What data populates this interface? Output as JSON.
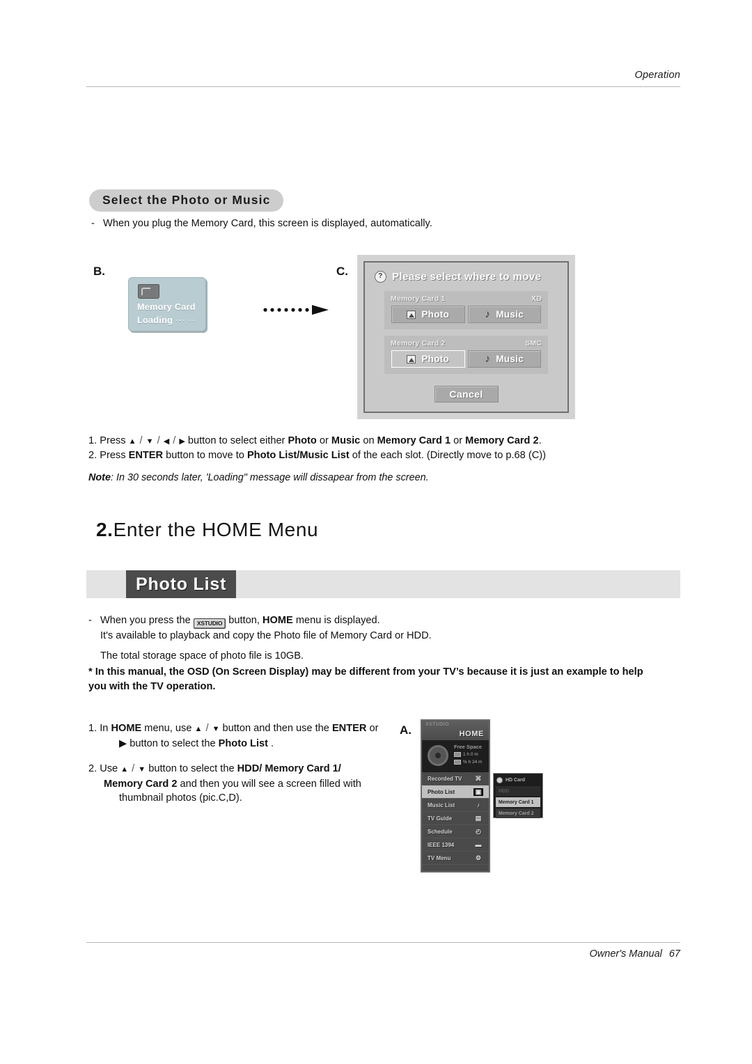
{
  "header": {
    "section_label": "Operation"
  },
  "footer": {
    "manual_label": "Owner's Manual",
    "page_number": "67"
  },
  "section": {
    "pill_title": "Select the Photo or Music",
    "lead_text": "When you plug the Memory Card, this screen is displayed, automatically."
  },
  "figure_b": {
    "label": "B.",
    "line1": "Memory Card",
    "line2": "Loading",
    "dots": "··· ··"
  },
  "figure_c": {
    "label": "C.",
    "title": "Please select where to move",
    "help_icon_glyph": "?",
    "slots": [
      {
        "name": "Memory Card 1",
        "type": "XD",
        "photo_label": "Photo",
        "music_label": "Music",
        "selected": "none"
      },
      {
        "name": "Memory Card 2",
        "type": "SMC",
        "photo_label": "Photo",
        "music_label": "Music",
        "selected": "photo"
      }
    ],
    "cancel_label": "Cancel"
  },
  "steps_top": {
    "s1_pre": "1. Press ",
    "s1_a": "▲",
    "s1_b": "▼",
    "s1_c": "◀",
    "s1_d": "▶",
    "s1_mid": " button to select either ",
    "s1_photo": "Photo",
    "s1_or": " or ",
    "s1_music": "Music",
    "s1_on": " on ",
    "s1_card1": "Memory Card 1",
    "s1_or2": " or ",
    "s1_card2": "Memory Card 2",
    "s1_end": ".",
    "s2_pre": "2. Press ",
    "s2_enter": "ENTER",
    "s2_mid": " button to move to ",
    "s2_lists": "Photo List/Music List",
    "s2_end": " of the each slot. (Directly move to p.68 (C))",
    "note_label": "Note",
    "note_text": ": In 30 seconds later, 'Loading\" message will dissapear from the screen."
  },
  "heading2": {
    "number": "2.",
    "text": "Enter the HOME Menu"
  },
  "banner": {
    "title": "Photo List"
  },
  "body": {
    "b1_dash": "-",
    "b1_pre": "When you press the ",
    "b1_btn": "XSTUDIO",
    "b1_mid": " button, ",
    "b1_home": "HOME",
    "b1_end": " menu is displayed.",
    "b2": "It's available to playback and copy the Photo file of Memory Card or HDD.",
    "b3": "The total storage space of photo file is 10GB.",
    "warn": "* In this manual, the OSD (On Screen Display) may be different from your TV’s because it is just an example to help you with the TV operation."
  },
  "steps_bottom": {
    "s1_pre": "1. In ",
    "s1_home": "HOME",
    "s1_mid1": " menu, use ",
    "s1_up": "▲",
    "s1_dn": "▼",
    "s1_mid2": " button and then use the ",
    "s1_enter": "ENTER",
    "s1_or": " or",
    "s1_line2_pre": "▶ button to select the ",
    "s1_photolist": "Photo List",
    "s1_line2_end": " .",
    "s2_pre": "2.  Use ",
    "s2_up": "▲",
    "s2_dn": "▼",
    "s2_mid": " button to select the ",
    "s2_hdd": "HDD/",
    "s2_card1": " Memory Card 1/",
    "s2_card2": "Memory Card 2",
    "s2_mid2": " and then you will see a screen filled with",
    "s2_end": "thumbnail photos (pic.C,D)."
  },
  "figure_a": {
    "label": "A.",
    "logo": "XSTUDIO",
    "home_title": "HOME",
    "free_space_label": "Free Space",
    "free_row1": "1 h 0 m",
    "free_row2": "% h 24 m",
    "menu_items": [
      {
        "label": "Recorded TV",
        "icon": "recorded-tv-icon",
        "glyph": "⌘",
        "selected": false
      },
      {
        "label": "Photo List",
        "icon": "photo-icon",
        "glyph": "▣",
        "selected": true
      },
      {
        "label": "Music List",
        "icon": "music-icon",
        "glyph": "♪",
        "selected": false
      },
      {
        "label": "TV Guide",
        "icon": "tv-guide-icon",
        "glyph": "▤",
        "selected": false
      },
      {
        "label": "Schedule",
        "icon": "clock-icon",
        "glyph": "◴",
        "selected": false
      },
      {
        "label": "IEEE 1394",
        "icon": "ieee1394-icon",
        "glyph": "▬",
        "selected": false
      },
      {
        "label": "TV Menu",
        "icon": "gear-icon",
        "glyph": "⚙",
        "selected": false
      }
    ],
    "popup": {
      "header": "HD Card",
      "items": [
        {
          "label": "HDD",
          "state": "dim"
        },
        {
          "label": "Memory Card 1",
          "state": "selected"
        },
        {
          "label": "Memory Card 2",
          "state": "normal"
        }
      ]
    }
  }
}
